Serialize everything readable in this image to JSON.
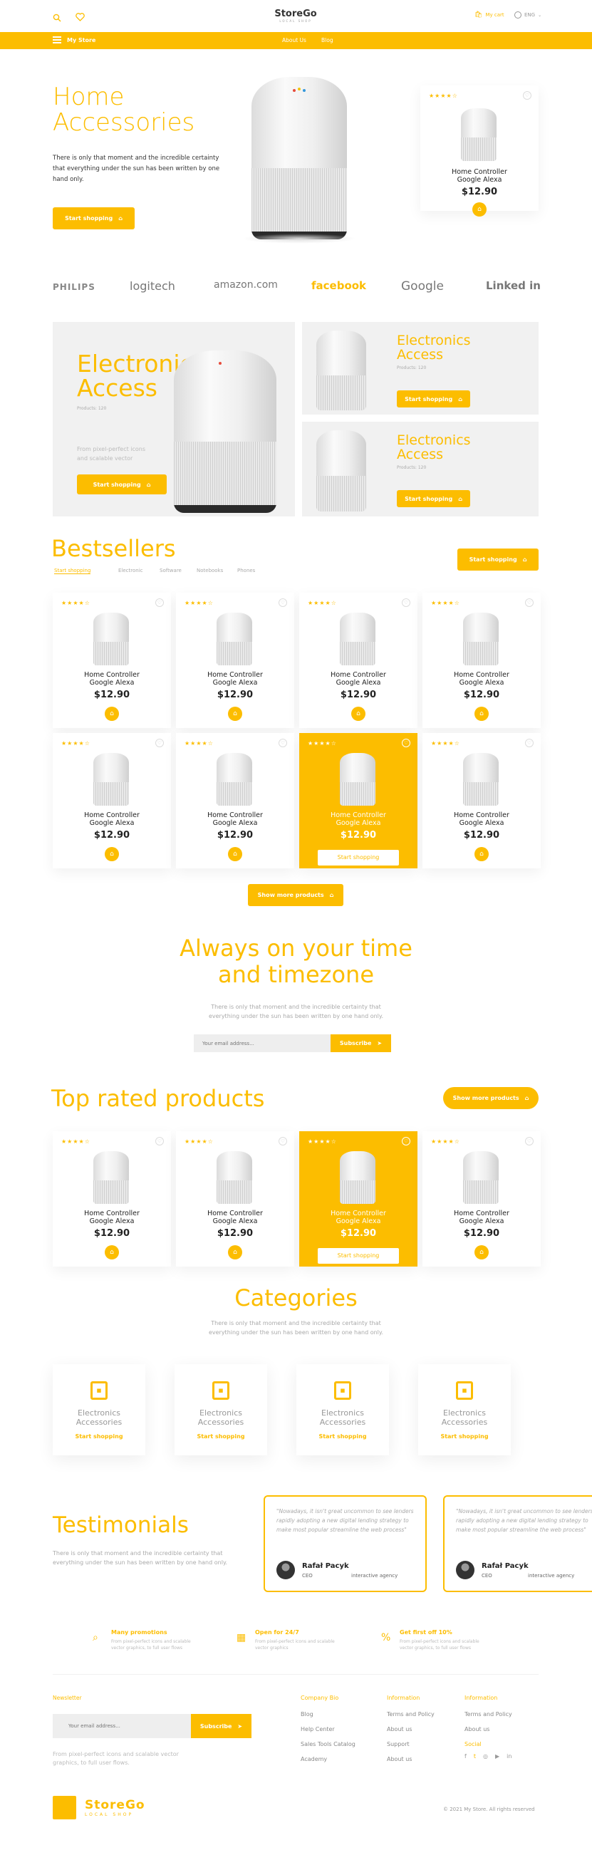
{
  "header": {
    "brand": "StoreGo",
    "brand_sub": "LOCAL SHOP",
    "my_cart": "My cart",
    "language": "ENG"
  },
  "nav": {
    "my_store": "My Store",
    "links": [
      "About Us",
      "Blog"
    ]
  },
  "hero": {
    "title_line1": "Home",
    "title_line2": "Accessories",
    "description": "There is only that moment and the incredible certainty that everything under the sun has been written by one hand only.",
    "button": "Start shopping",
    "card": {
      "stars": "★★★★☆",
      "name_line1": "Home Controller",
      "name_line2": "Google Alexa",
      "price": "$12.90"
    }
  },
  "brands": [
    "PHILIPS",
    "logitech",
    "amazon.com",
    "facebook",
    "Google",
    "Linked in"
  ],
  "promo": {
    "big": {
      "title_line1": "Electronics",
      "title_line2": "Access",
      "products": "Products: 120",
      "description": "From pixel-perfect icons and scalable vector",
      "button": "Start shopping"
    },
    "small": [
      {
        "title_line1": "Electronics",
        "title_line2": "Access",
        "products": "Products: 120",
        "button": "Start shopping"
      },
      {
        "title_line1": "Electronics",
        "title_line2": "Access",
        "products": "Products: 120",
        "button": "Start shopping"
      }
    ]
  },
  "bestsellers": {
    "title": "Bestsellers",
    "tabs": [
      "Start shopping",
      "Electronic",
      "Software",
      "Notebooks",
      "Phones"
    ],
    "button": "Start shopping",
    "more_button": "Show more products"
  },
  "product": {
    "stars": "★★★★☆",
    "name_line1": "Home Controller",
    "name_line2": "Google Alexa",
    "price": "$12.90",
    "hover_button": "Start shopping"
  },
  "newsletter_mid": {
    "title_line1": "Always on your time",
    "title_line2": "and timezone",
    "description_line1": "There is only that moment and the incredible certainty that",
    "description_line2": "everything under the sun has been written by one hand only.",
    "placeholder": "Your email address...",
    "button": "Subscribe"
  },
  "top_rated": {
    "title": "Top rated products",
    "button": "Show more products"
  },
  "categories": {
    "title": "Categories",
    "description_line1": "There is only that moment and the incredible certainty that",
    "description_line2": "everything under the sun has been written by one hand only.",
    "items": [
      {
        "line1": "Electronics",
        "line2": "Accessories",
        "cta": "Start shopping"
      },
      {
        "line1": "Electronics",
        "line2": "Accessories",
        "cta": "Start shopping"
      },
      {
        "line1": "Electronics",
        "line2": "Accessories",
        "cta": "Start shopping"
      },
      {
        "line1": "Electronics",
        "line2": "Accessories",
        "cta": "Start shopping"
      }
    ]
  },
  "testimonials": {
    "title": "Testimonials",
    "description": "There is only that moment and the incredible certainty that everything under the sun has been written by one hand only.",
    "items": [
      {
        "quote": "\"Nowadays, it isn't great uncommon to see lenders rapidly adopting a new digital lending strategy to make most popular streamline the web process\"",
        "name": "Rafał Pacyk",
        "role": "CEO",
        "company": "interactive agency"
      },
      {
        "quote": "\"Nowadays, it isn't great uncommon to see lenders rapidly adopting a new digital lending strategy to make most popular streamline the web process\"",
        "name": "Rafał Pacyk",
        "role": "CEO",
        "company": "interactive agency"
      }
    ]
  },
  "features": [
    {
      "title": "Many promotions",
      "text": "From pixel-perfect icons and scalable vector graphics, to full user flows"
    },
    {
      "title": "Open for 24/7",
      "text": "From pixel-perfect icons and scalable vector graphics"
    },
    {
      "title": "Get first off 10%",
      "text": "From pixel-perfect icons and scalable vector graphics, to full user flows"
    }
  ],
  "footer": {
    "newsletter_label": "Newsletter",
    "placeholder": "Your email address...",
    "subscribe": "Subscribe",
    "description": "From pixel-perfect icons and scalable vector graphics, to full user flows.",
    "col1": {
      "title": "Company Bio",
      "links": [
        "Blog",
        "Help Center",
        "Sales Tools Catalog",
        "Academy"
      ]
    },
    "col2": {
      "title": "Information",
      "links": [
        "Terms and Policy",
        "About us",
        "Support",
        "About us"
      ]
    },
    "col3": {
      "title": "Information",
      "links": [
        "Terms and Policy",
        "About us"
      ],
      "social_label": "Social"
    },
    "brand": "StoreGo",
    "brand_sub": "LOCAL SHOP",
    "copyright": "© 2021 My Store. All rights reserved"
  }
}
